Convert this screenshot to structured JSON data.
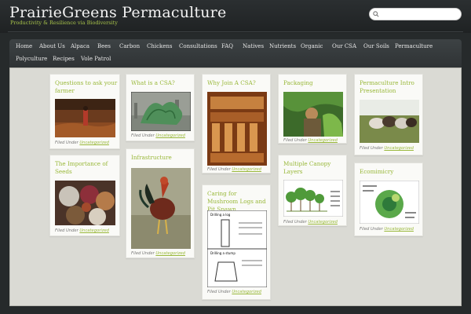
{
  "site": {
    "title": "PrairieGreens Permaculture",
    "tagline": "Productivity & Resilience via Biodiversity"
  },
  "search": {
    "placeholder": "",
    "value": ""
  },
  "nav": {
    "row1": [
      "Home",
      "About Us",
      "Alpaca",
      "Bees",
      "Carbon",
      "Chickens",
      "Consultations",
      "FAQ",
      "Natives",
      "Nutrients",
      "Organic",
      "Our CSA",
      "Our Soils",
      "Permaculture"
    ],
    "row2": [
      "Polyculture",
      "Recipes",
      "Vole Patrol"
    ]
  },
  "filed_prefix": "Filed Under",
  "filed_category": "Uncategorized",
  "posts": [
    {
      "title": "Questions to ask your farmer"
    },
    {
      "title": "What is a CSA?"
    },
    {
      "title": "Why Join A CSA?"
    },
    {
      "title": "Packaging"
    },
    {
      "title": "Permaculture Intro Presentation"
    },
    {
      "title": "The Importance of Seeds"
    },
    {
      "title": "Infrastructure"
    },
    {
      "title": "Caring for Mushroom Logs and Pit Spawn"
    },
    {
      "title": "Multiple Canopy Layers"
    },
    {
      "title": "Ecomimicry"
    }
  ],
  "thumbs": {
    "csa_chart": {
      "caption": ""
    },
    "mushroom": {
      "label_a": "Drilling a log",
      "label_b": "Drilling a stump"
    }
  }
}
